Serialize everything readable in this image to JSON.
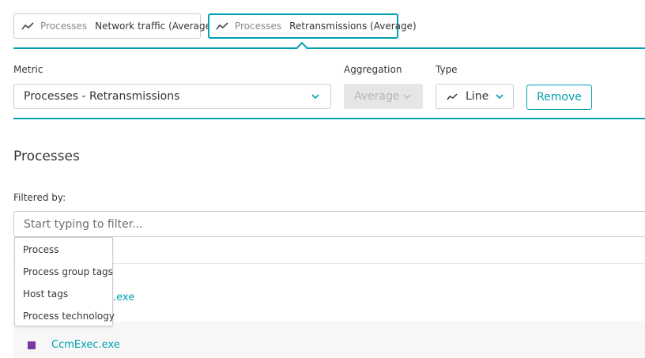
{
  "metric_tabs": [
    {
      "category": "Processes",
      "name": "Network traffic (Average)",
      "icon": "line-chart-icon",
      "active": false
    },
    {
      "category": "Processes",
      "name": "Retransmissions (Average)",
      "icon": "line-chart-icon",
      "active": true
    }
  ],
  "config": {
    "metric_label": "Metric",
    "metric_value": "Processes - Retransmissions",
    "aggregation_label": "Aggregation",
    "aggregation_value": "Average",
    "type_label": "Type",
    "type_value": "Line",
    "remove_label": "Remove"
  },
  "section": {
    "title": "Processes",
    "filtered_by_label": "Filtered by:",
    "filter_placeholder": "Start typing to filter..."
  },
  "filter_dropdown": {
    "options": [
      "Process",
      "Process group tags",
      "Host tags",
      "Process technology"
    ]
  },
  "process_list": [
    {
      "name": ".exe",
      "color": null
    },
    {
      "name": "CcmExec.exe",
      "color": "#7c38a1"
    }
  ],
  "colors": {
    "accent": "#00a1b2",
    "border": "#cccccc",
    "disabled": "#e6e6e6"
  }
}
